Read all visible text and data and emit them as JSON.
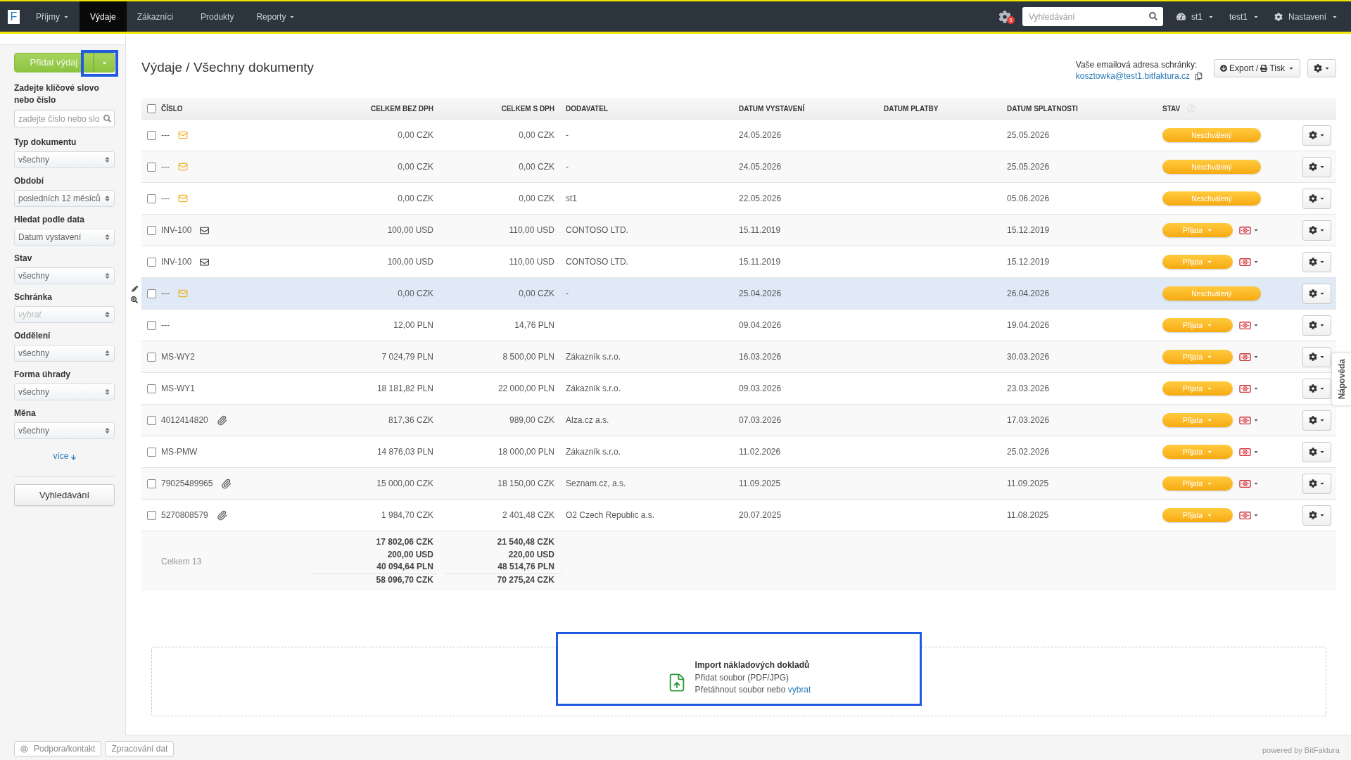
{
  "top_nav": {
    "logo": "F",
    "items": [
      {
        "label": "Příjmy",
        "dropdown": true,
        "selected": false
      },
      {
        "label": "Výdaje",
        "dropdown": false,
        "selected": true
      },
      {
        "label": "Zákazníci",
        "dropdown": false,
        "selected": false
      },
      {
        "label": "Produkty",
        "dropdown": false,
        "selected": false
      },
      {
        "label": "Reporty",
        "dropdown": true,
        "selected": false
      }
    ],
    "notification_count": "5",
    "search": {
      "placeholder": "Vyhledávání"
    },
    "menus": [
      {
        "kind": "dashboard",
        "label": "st1"
      },
      {
        "kind": "user",
        "label": "test1"
      },
      {
        "kind": "settings",
        "label": "Nastavení"
      }
    ]
  },
  "sidebar": {
    "add_button": {
      "label": "Přidat výdaj",
      "menu_focused": true
    },
    "keyword": {
      "label": "Zadejte klíčové slovo nebo číslo",
      "placeholder": "zadejte číslo nebo slo"
    },
    "filters": [
      {
        "label": "Typ dokumentu",
        "value": "všechny"
      },
      {
        "label": "Období",
        "value": "posledních 12 měsíců"
      },
      {
        "label": "Hledat podle data",
        "value": "Datum vystavení"
      },
      {
        "label": "Stav",
        "value": "všechny"
      },
      {
        "label": "Schránka",
        "placeholder": "vybrat"
      },
      {
        "label": "Oddělení",
        "value": "všechny"
      },
      {
        "label": "Forma úhrady",
        "value": "všechny"
      },
      {
        "label": "Měna",
        "value": "všechny"
      }
    ],
    "more_link": "více",
    "search_button": "Vyhledávání"
  },
  "header": {
    "title": "Výdaje / Všechny dokumenty",
    "inbox_label": "Vaše emailová adresa schránky:",
    "inbox_email": "kosztowka@test1.bitfaktura.cz",
    "export_label": "Export /",
    "print_label": "Tisk"
  },
  "table": {
    "select_all": {
      "checked": false
    },
    "columns": [
      {
        "label": "ČÍSLO"
      },
      {
        "label": "CELKEM BEZ DPH"
      },
      {
        "label": "CELKEM S DPH"
      },
      {
        "label": "DODAVATEL"
      },
      {
        "label": "DATUM VYSTAVENÍ"
      },
      {
        "label": "DATUM PLATBY"
      },
      {
        "label": "DATUM SPLATNOSTI"
      },
      {
        "label": "STAV",
        "help": true
      }
    ],
    "rows": [
      {
        "checked": false,
        "hovered": false,
        "number": "---",
        "attachment": {
          "kind": "mail_new"
        },
        "net": "0,00 CZK",
        "gross": "0,00 CZK",
        "supplier": "-",
        "issued": "24.05.2026",
        "due": "25.05.2026",
        "status": {
          "kind": "unapproved",
          "label": "Neschválený"
        }
      },
      {
        "checked": false,
        "hovered": false,
        "number": "---",
        "attachment": {
          "kind": "mail_new"
        },
        "net": "0,00 CZK",
        "gross": "0,00 CZK",
        "supplier": "-",
        "issued": "24.05.2026",
        "due": "25.05.2026",
        "status": {
          "kind": "unapproved",
          "label": "Neschválený"
        }
      },
      {
        "checked": false,
        "hovered": false,
        "number": "---",
        "attachment": {
          "kind": "mail_new"
        },
        "net": "0,00 CZK",
        "gross": "0,00 CZK",
        "supplier": "st1",
        "issued": "22.05.2026",
        "due": "05.06.2026",
        "status": {
          "kind": "unapproved",
          "label": "Neschválený"
        }
      },
      {
        "checked": false,
        "hovered": false,
        "number": "INV-100",
        "attachment": {
          "kind": "mail"
        },
        "net": "100,00 USD",
        "gross": "110,00 USD",
        "supplier": "CONTOSO LTD.",
        "issued": "15.11.2019",
        "due": "15.12.2019",
        "status": {
          "kind": "accepted",
          "label": "Přijata"
        }
      },
      {
        "checked": false,
        "hovered": false,
        "number": "INV-100",
        "attachment": {
          "kind": "mail"
        },
        "net": "100,00 USD",
        "gross": "110,00 USD",
        "supplier": "CONTOSO LTD.",
        "issued": "15.11.2019",
        "due": "15.12.2019",
        "status": {
          "kind": "accepted",
          "label": "Přijata"
        }
      },
      {
        "checked": false,
        "hovered": true,
        "number": "---",
        "attachment": {
          "kind": "mail_new"
        },
        "net": "0,00 CZK",
        "gross": "0,00 CZK",
        "supplier": "-",
        "issued": "25.04.2026",
        "due": "26.04.2026",
        "status": {
          "kind": "unapproved",
          "label": "Neschválený"
        }
      },
      {
        "checked": false,
        "hovered": false,
        "number": "---",
        "net": "12,00 PLN",
        "gross": "14,76 PLN",
        "issued": "09.04.2026",
        "due": "19.04.2026",
        "status": {
          "kind": "accepted",
          "label": "Přijata"
        }
      },
      {
        "checked": false,
        "hovered": false,
        "number": "MS-WY2",
        "net": "7 024,79 PLN",
        "gross": "8 500,00 PLN",
        "supplier": "Zákazník s.r.o.",
        "issued": "16.03.2026",
        "due": "30.03.2026",
        "status": {
          "kind": "accepted",
          "label": "Přijata"
        }
      },
      {
        "checked": false,
        "hovered": false,
        "number": "MS-WY1",
        "net": "18 181,82 PLN",
        "gross": "22 000,00 PLN",
        "supplier": "Zákazník s.r.o.",
        "issued": "09.03.2026",
        "due": "23.03.2026",
        "status": {
          "kind": "accepted",
          "label": "Přijata"
        }
      },
      {
        "checked": false,
        "hovered": false,
        "number": "4012414820",
        "attachment": {
          "kind": "clip"
        },
        "net": "817,36 CZK",
        "gross": "989,00 CZK",
        "supplier": "Alza.cz a.s.",
        "issued": "07.03.2026",
        "due": "17.03.2026",
        "status": {
          "kind": "accepted",
          "label": "Přijata"
        }
      },
      {
        "checked": false,
        "hovered": false,
        "number": "MS-PMW",
        "net": "14 876,03 PLN",
        "gross": "18 000,00 PLN",
        "supplier": "Zákazník s.r.o.",
        "issued": "11.02.2026",
        "due": "25.02.2026",
        "status": {
          "kind": "accepted",
          "label": "Přijata"
        }
      },
      {
        "checked": false,
        "hovered": false,
        "number": "79025489965",
        "attachment": {
          "kind": "clip"
        },
        "net": "15 000,00 CZK",
        "gross": "18 150,00 CZK",
        "supplier": "Seznam.cz, a.s.",
        "issued": "11.09.2025",
        "due": "11.09.2025",
        "status": {
          "kind": "accepted",
          "label": "Přijata"
        }
      },
      {
        "checked": false,
        "hovered": false,
        "number": "5270808579",
        "attachment": {
          "kind": "clip"
        },
        "net": "1 984,70 CZK",
        "gross": "2 401,48 CZK",
        "supplier": "O2 Czech Republic a.s.",
        "issued": "20.07.2025",
        "due": "11.08.2025",
        "status": {
          "kind": "accepted",
          "label": "Přijata"
        }
      }
    ],
    "totals": {
      "label": "Celkem 13",
      "net": [
        "17 802,06 CZK",
        "200,00 USD",
        "40 094,64 PLN"
      ],
      "net_total": "58 096,70 CZK",
      "gross": [
        "21 540,48 CZK",
        "220,00 USD",
        "48 514,76 PLN"
      ],
      "gross_total": "70 275,24 CZK"
    }
  },
  "import": {
    "focused": true,
    "title": "Import nákladových dokladů",
    "subtitle": "Přidat soubor (PDF/JPG)",
    "drag_text": "Přetáhnout soubor nebo",
    "link": "vybrat"
  },
  "help_tab": "Nápověda",
  "footer": {
    "links": [
      "Podpora/kontakt",
      "Zpracování dat"
    ],
    "powered_by": "powered by BitFaktura"
  }
}
